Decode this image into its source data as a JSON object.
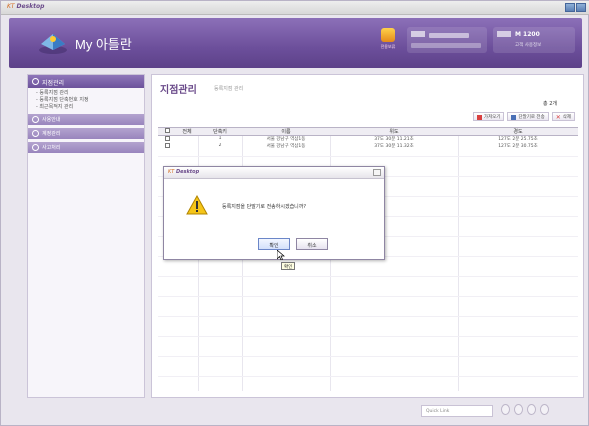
{
  "window": {
    "title_brand": "KT",
    "title_app": "Desktop"
  },
  "header": {
    "title": "My 아틀란",
    "icon_label": "전용보류",
    "account_label": "M 1200",
    "account_sub": "고객 사용정보"
  },
  "sidebar": {
    "active_section": "지점관리",
    "sub_items": [
      "- 등록지점 관리",
      "- 등록지점 단축번호 지정",
      "- 최근목적지 관리"
    ],
    "groups": [
      "사용안내",
      "계정관리",
      "사고처리"
    ]
  },
  "main": {
    "title": "지점관리",
    "subtitle": "등록지점 관리",
    "count": "총 2개",
    "buttons": [
      "가져오기",
      "단말기로 전송",
      "삭제"
    ],
    "columns": [
      "전체",
      "단축키",
      "이름",
      "위도",
      "경도"
    ],
    "rows": [
      [
        "",
        "1",
        "서울 강남구 역삼1동",
        "37도 30분 11.21초",
        "127도 2분 25.75초"
      ],
      [
        "",
        "2",
        "서울 강남구 역삼1동",
        "37도 30분 11.32초",
        "127도 2분 30.75초"
      ]
    ]
  },
  "dialog": {
    "title_brand": "KT",
    "title_app": "Desktop",
    "message": "등록지점을 단말기로 전송하시겠습니까?",
    "ok_label": "확인",
    "cancel_label": "취소",
    "tooltip": "확인"
  },
  "footer": {
    "quick_link": "Quick Link"
  },
  "colors": {
    "header_purple": "#6c4f9b",
    "accent_title": "#6a4a8a",
    "warning_yellow": "#f5c518"
  }
}
